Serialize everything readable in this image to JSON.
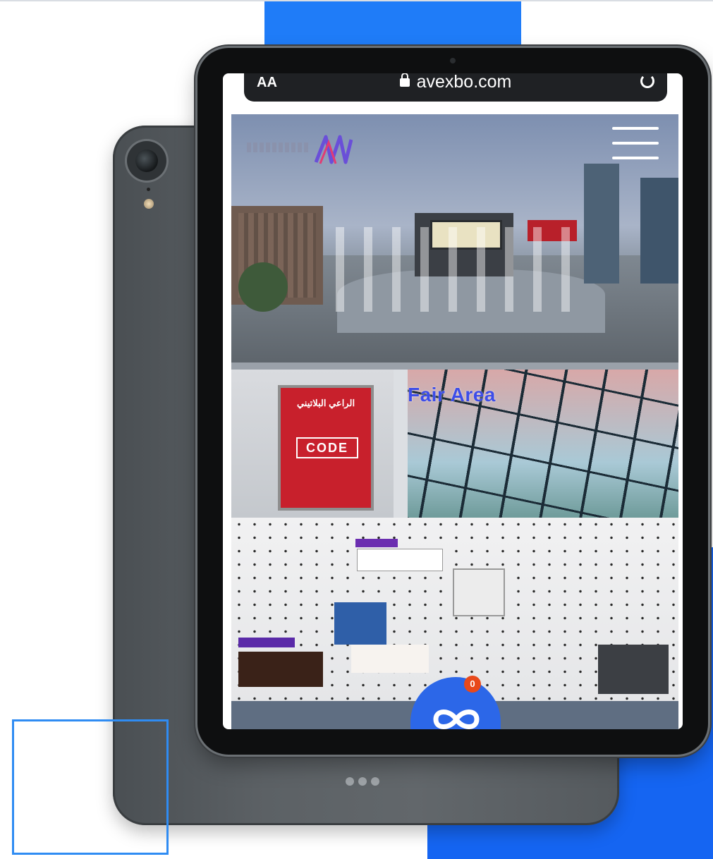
{
  "browser": {
    "text_size_label": "AA",
    "host": "avexbo.com"
  },
  "scene_bottom": {
    "area_label": "Fair Area",
    "billboard_arabic": "الراعي البلاتيني",
    "billboard_logo": "CODE"
  },
  "fab": {
    "badge_count": "0"
  },
  "colors": {
    "accent_blue": "#1f7cf8",
    "fab_blue": "#2c67e8",
    "badge_orange": "#e8491b",
    "area_label": "#3d4de8"
  },
  "icons": [
    "lock-icon",
    "reload-icon",
    "menu-icon",
    "infinity-icon"
  ]
}
